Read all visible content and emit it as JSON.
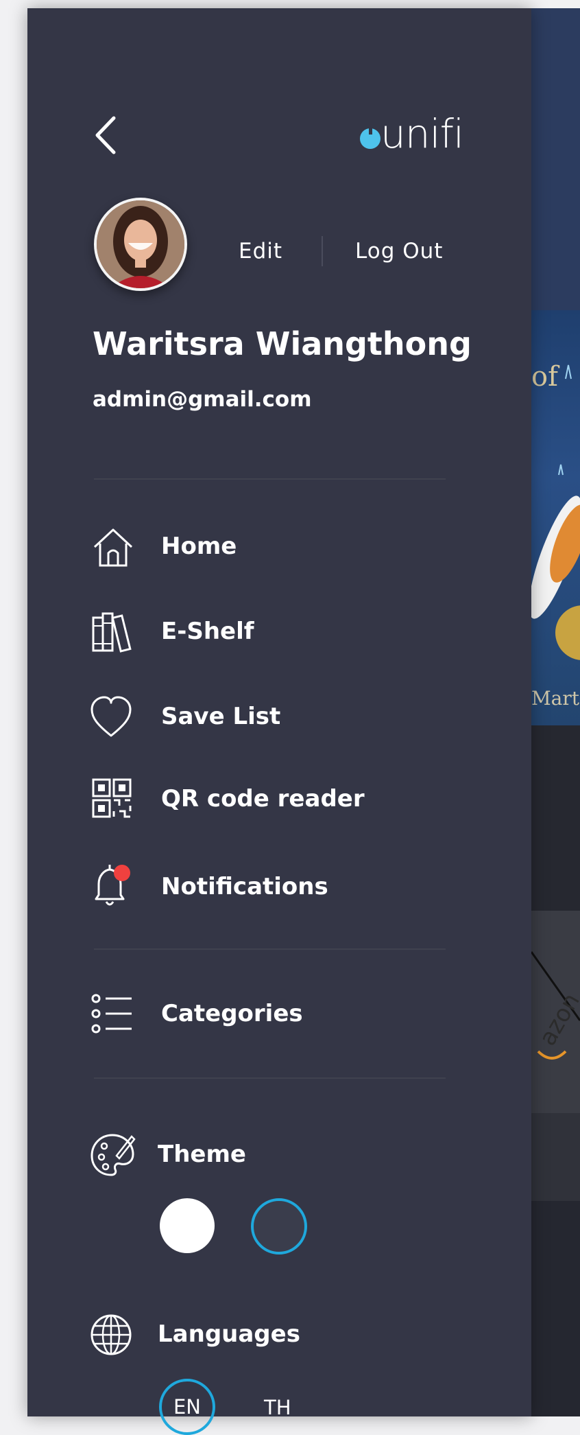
{
  "header": {
    "back_icon": "chevron-left-icon",
    "logo_text": "unifi",
    "logo_color": "#4ec3ec"
  },
  "profile": {
    "avatar": "user-avatar",
    "edit_label": "Edit",
    "logout_label": "Log Out",
    "name": "Waritsra Wiangthong",
    "email": "admin@gmail.com"
  },
  "menu": {
    "items": [
      {
        "label": "Home",
        "icon": "home-icon"
      },
      {
        "label": "E-Shelf",
        "icon": "books-icon"
      },
      {
        "label": "Save List",
        "icon": "heart-icon"
      },
      {
        "label": "QR code reader",
        "icon": "qr-code-icon"
      },
      {
        "label": "Notifications",
        "icon": "bell-icon",
        "has_badge": true,
        "badge_color": "#f0413f"
      }
    ],
    "categories": {
      "label": "Categories",
      "icon": "list-icon"
    }
  },
  "theme": {
    "label": "Theme",
    "icon": "palette-icon",
    "options": [
      "light",
      "dark"
    ],
    "selected": "dark",
    "accent": "#1fa8dc"
  },
  "languages": {
    "label": "Languages",
    "icon": "globe-icon",
    "options": [
      "EN",
      "TH"
    ],
    "selected": "EN"
  },
  "colors": {
    "drawer_bg": "#343646",
    "text": "#ffffff",
    "accent": "#1fa8dc"
  }
}
